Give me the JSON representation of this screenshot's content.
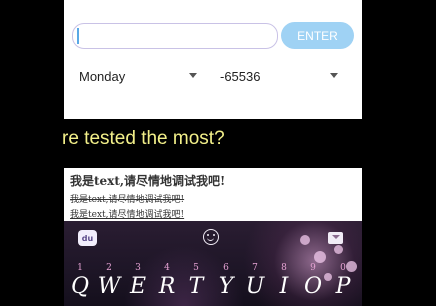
{
  "form": {
    "input_value": "",
    "enter_label": "ENTER",
    "day_select_value": "Monday",
    "number_select_value": "-65536"
  },
  "question": "re tested the most?",
  "text_lines": {
    "line1": "我是text,请尽情地调试我吧!",
    "line2": "我是text,请尽情地调试我吧!",
    "line3": "我是text,请尽情地调试我吧!"
  },
  "keyboard": {
    "logo": "du",
    "keys": [
      {
        "num": "1",
        "letter": "Q"
      },
      {
        "num": "2",
        "letter": "W"
      },
      {
        "num": "3",
        "letter": "E"
      },
      {
        "num": "4",
        "letter": "R"
      },
      {
        "num": "5",
        "letter": "T"
      },
      {
        "num": "6",
        "letter": "Y"
      },
      {
        "num": "7",
        "letter": "U"
      },
      {
        "num": "8",
        "letter": "I"
      },
      {
        "num": "9",
        "letter": "O"
      },
      {
        "num": "0",
        "letter": "P"
      }
    ]
  }
}
